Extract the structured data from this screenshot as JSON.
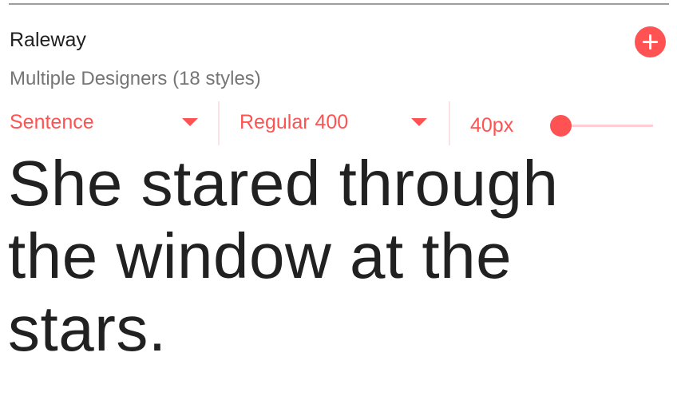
{
  "card": {
    "font_name": "Raleway",
    "designer": "Multiple Designers (18 styles)",
    "add_icon": "plus-circle-icon"
  },
  "controls": {
    "case_label": "Sentence",
    "weight_label": "Regular 400",
    "size_label": "40px",
    "size_slider_level": 0.0
  },
  "preview": {
    "text": "She stared through the window at the stars."
  },
  "colors": {
    "accent": "#ff5252",
    "accent_light": "#ffcdd2",
    "text_primary": "#212121",
    "text_secondary": "#757575"
  }
}
